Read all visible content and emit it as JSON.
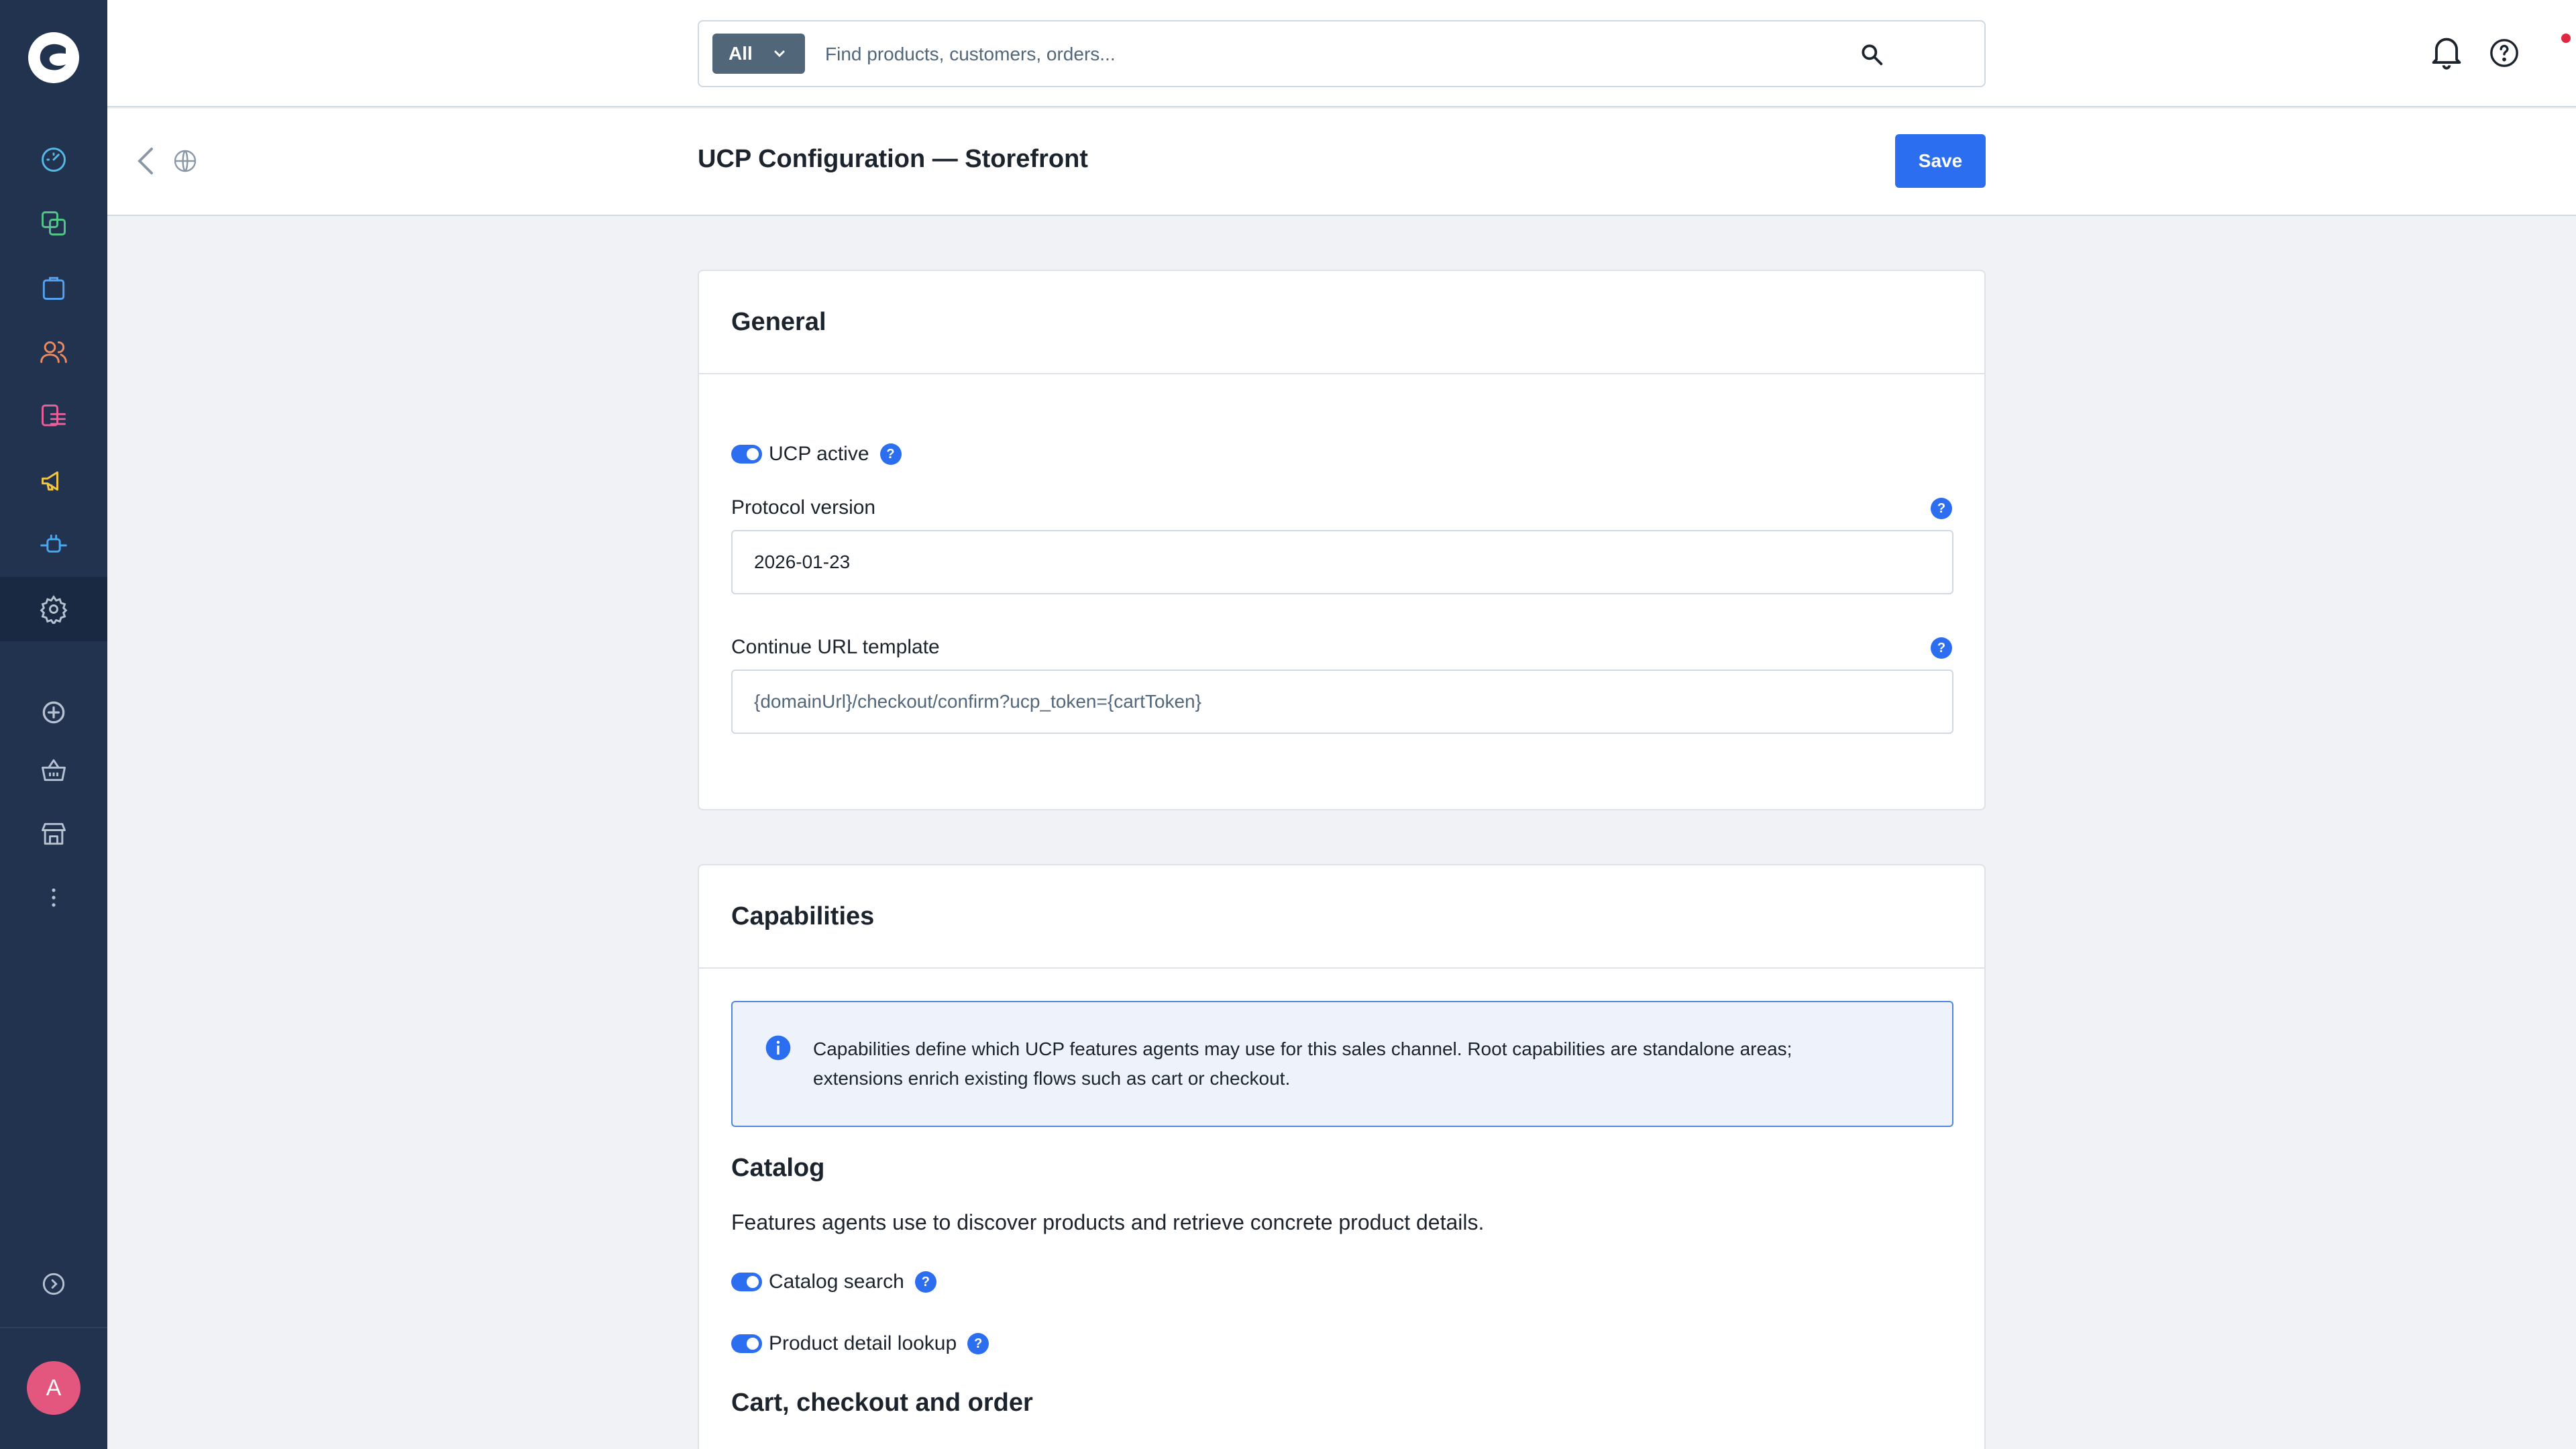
{
  "search": {
    "scope": "All",
    "placeholder": "Find products, customers, orders..."
  },
  "sidebar": {
    "items": [
      {
        "name": "dashboard-icon",
        "color": "#54b9e6"
      },
      {
        "name": "catalogues-icon",
        "color": "#52c68a"
      },
      {
        "name": "orders-icon",
        "color": "#55a2f0"
      },
      {
        "name": "customers-icon",
        "color": "#f08a5d"
      },
      {
        "name": "content-icon",
        "color": "#e85f9a"
      },
      {
        "name": "marketing-icon",
        "color": "#f2c744"
      },
      {
        "name": "extensions-icon",
        "color": "#4aa8f0"
      },
      {
        "name": "settings-icon",
        "color": "#b6c2d0"
      },
      {
        "name": "add-icon",
        "color": "#b6c2d0"
      },
      {
        "name": "basket-icon",
        "color": "#b6c2d0"
      },
      {
        "name": "store-icon",
        "color": "#b6c2d0"
      },
      {
        "name": "more-icon",
        "color": "#b6c2d0"
      }
    ],
    "avatar_initial": "A"
  },
  "header": {
    "title": "UCP Configuration — Storefront",
    "save_label": "Save"
  },
  "general": {
    "title": "General",
    "ucp_active_label": "UCP active",
    "ucp_active": true,
    "protocol_version_label": "Protocol version",
    "protocol_version_value": "2026-01-23",
    "continue_url_label": "Continue URL template",
    "continue_url_placeholder": "{domainUrl}/checkout/confirm?ucp_token={cartToken}"
  },
  "capabilities": {
    "title": "Capabilities",
    "info_line1": "Capabilities define which UCP features agents may use for this sales channel. Root capabilities are standalone areas;",
    "info_line2": "extensions enrich existing flows such as cart or checkout.",
    "catalog": {
      "title": "Catalog",
      "description": "Features agents use to discover products and retrieve concrete product details.",
      "catalog_search_label": "Catalog search",
      "catalog_search": true,
      "product_detail_label": "Product detail lookup",
      "product_detail": true
    },
    "cart_title": "Cart, checkout and order"
  },
  "colors": {
    "sidebar": "#223350",
    "accent": "#2c6ef0",
    "avatar": "#e3577f"
  }
}
